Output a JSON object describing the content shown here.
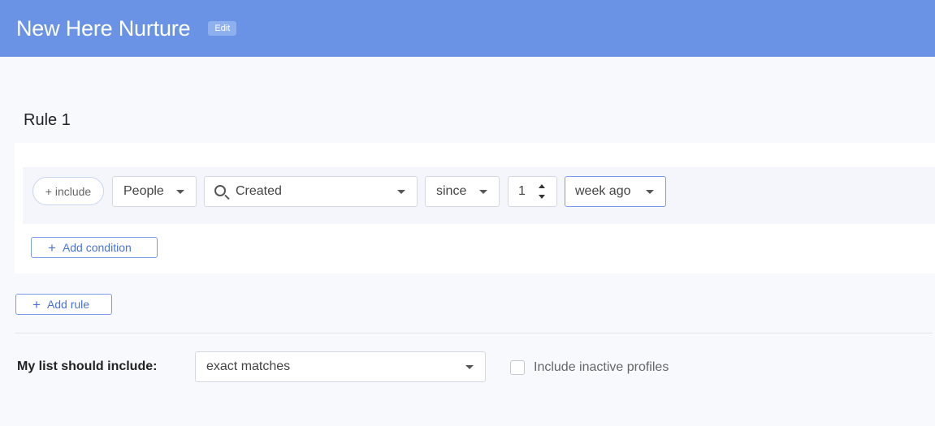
{
  "header": {
    "title": "New Here Nurture",
    "edit_label": "Edit",
    "background_color": "#6a93e6"
  },
  "rule": {
    "title": "Rule 1",
    "include_pill": "+ include",
    "entity_select": "People",
    "property_search": "Created",
    "operator_select": "since",
    "amount": "1",
    "unit_select": "week ago",
    "add_condition_label": "Add condition"
  },
  "add_rule_label": "Add rule",
  "footer": {
    "label": "My list should include:",
    "match_select": "exact matches",
    "inactive_label": "Include inactive profiles",
    "inactive_checked": false
  },
  "icons": {
    "search": "search-icon",
    "caret": "chevron-down-icon",
    "plus": "plus-icon",
    "stepper": "stepper-icon"
  }
}
